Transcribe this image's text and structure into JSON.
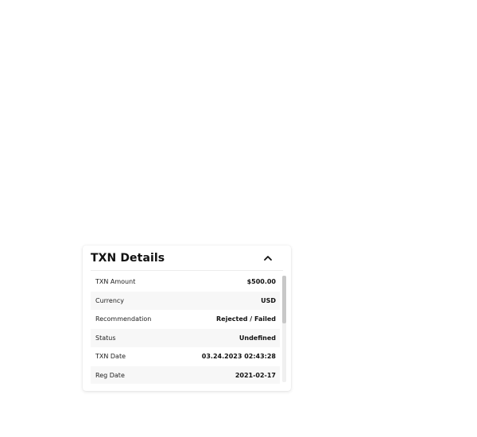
{
  "panel": {
    "title": "TXN Details",
    "collapse_icon": "chevron-up-icon",
    "rows": [
      {
        "label": "TXN Amount",
        "value": "$500.00"
      },
      {
        "label": "Currency",
        "value": "USD"
      },
      {
        "label": "Recommendation",
        "value": "Rejected / Failed"
      },
      {
        "label": "Status",
        "value": "Undefined"
      },
      {
        "label": "TXN Date",
        "value": "03.24.2023 02:43:28"
      },
      {
        "label": "Reg Date",
        "value": "2021-02-17"
      }
    ]
  },
  "colors": {
    "title": "#111111",
    "row_alt_bg": "#f7f7f7",
    "scroll_thumb": "#c8c8c8"
  }
}
